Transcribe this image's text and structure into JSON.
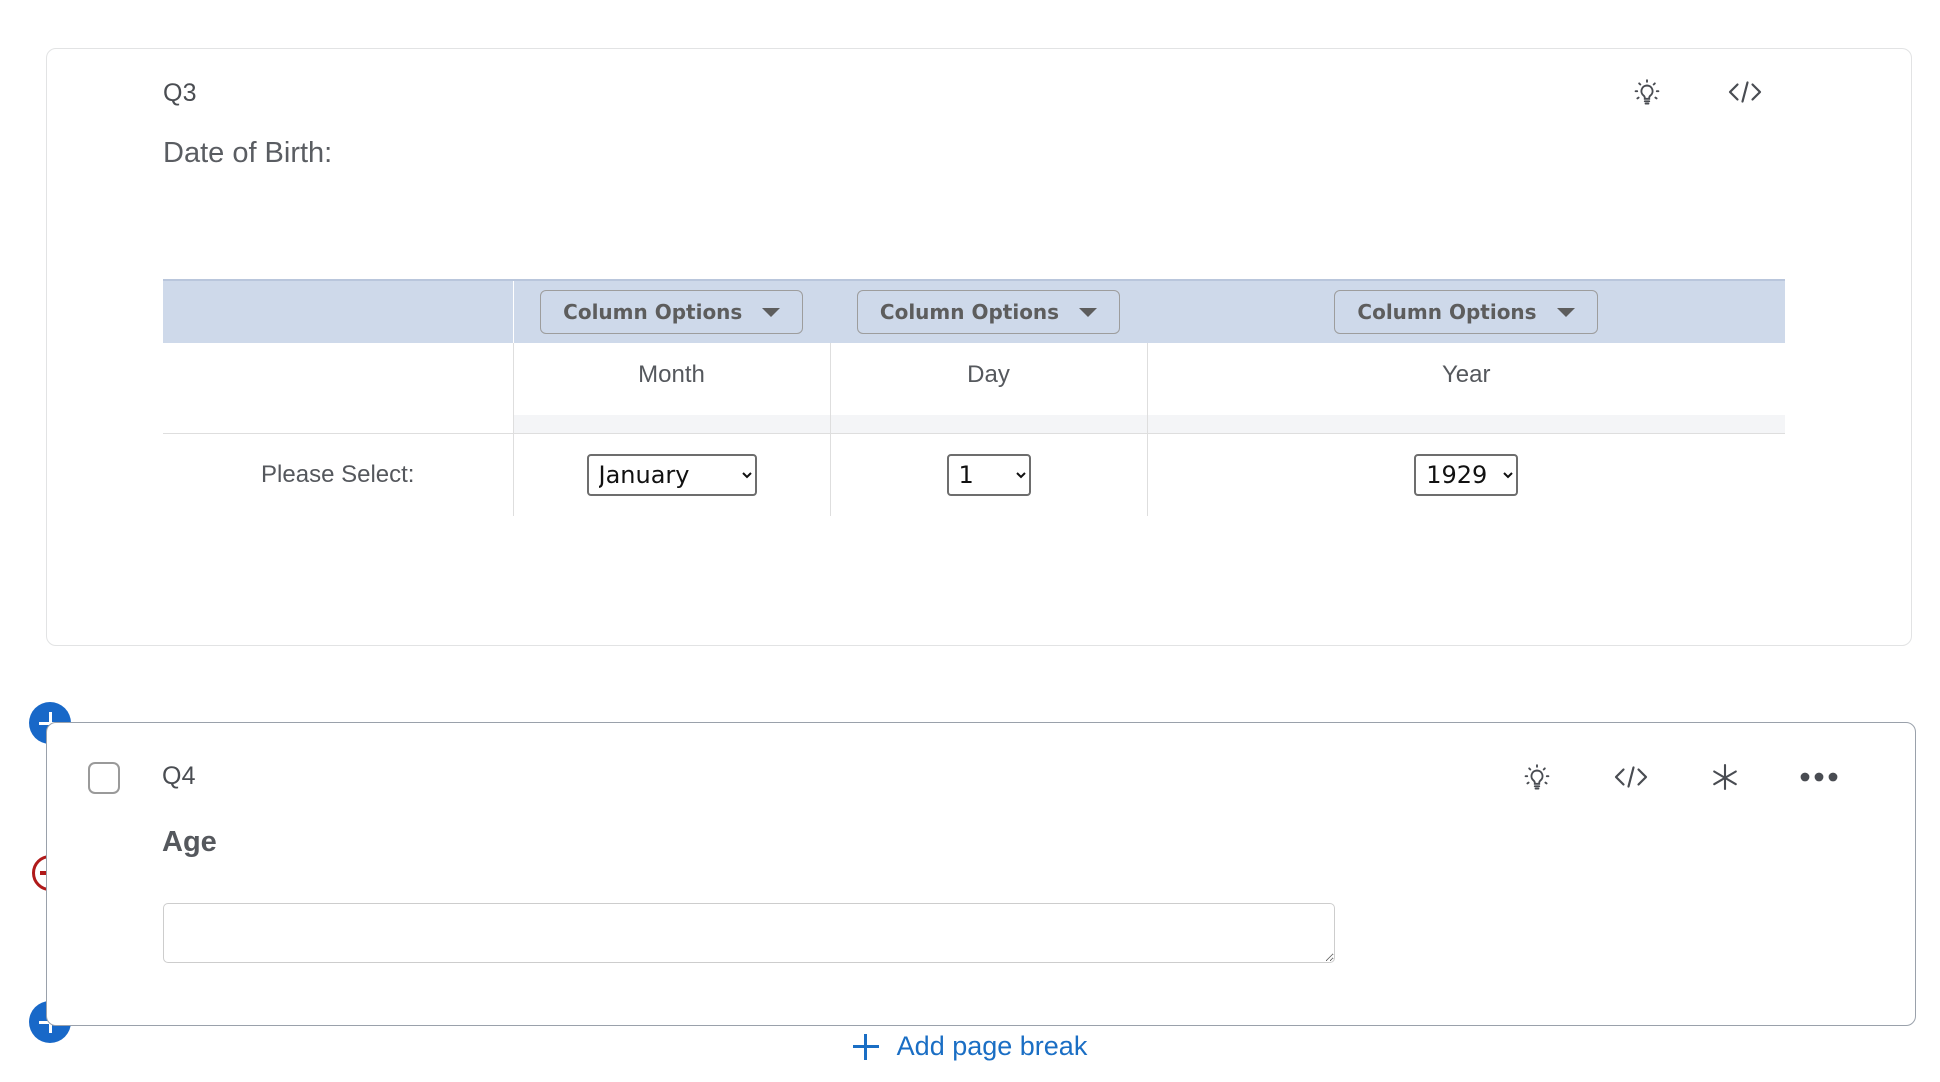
{
  "q3": {
    "number_label": "Q3",
    "title": "Date of Birth:",
    "icons": [
      {
        "name": "lightbulb-icon",
        "label": "Insights"
      },
      {
        "name": "code-icon",
        "label": "HTML view"
      }
    ],
    "table": {
      "column_options_label": "Column Options",
      "header_buttons": [
        "Column Options",
        "Column Options",
        "Column Options"
      ],
      "column_headers": [
        "",
        "Month",
        "Day",
        "Year"
      ],
      "row_label": "Please Select:",
      "selects": [
        {
          "name": "month-select",
          "value": "January"
        },
        {
          "name": "day-select",
          "value": "1"
        },
        {
          "name": "year-select",
          "value": "1929"
        }
      ]
    }
  },
  "q4": {
    "number_label": "Q4",
    "title": "Age",
    "checkbox_checked": false,
    "textarea_value": "",
    "textarea_placeholder": "",
    "icons": [
      {
        "name": "lightbulb-icon",
        "label": "Insights"
      },
      {
        "name": "code-icon",
        "label": "HTML view"
      },
      {
        "name": "asterisk-icon",
        "label": "Required"
      },
      {
        "name": "ellipsis-icon",
        "label": "More options"
      }
    ]
  },
  "rail": {
    "add_above_label": "Add question above",
    "remove_label": "Remove question",
    "add_below_label": "Add question below"
  },
  "footer": {
    "add_page_break_label": "Add page break",
    "add_page_break_icon": "plus-icon"
  },
  "colors": {
    "accent_blue": "#1868c8",
    "link_blue": "#1a6ec4",
    "remove_red": "#b01a1a",
    "table_header_blue": "#ced9ea",
    "card_border": "#e2e3e4",
    "active_card_border": "#9aa1ab"
  }
}
